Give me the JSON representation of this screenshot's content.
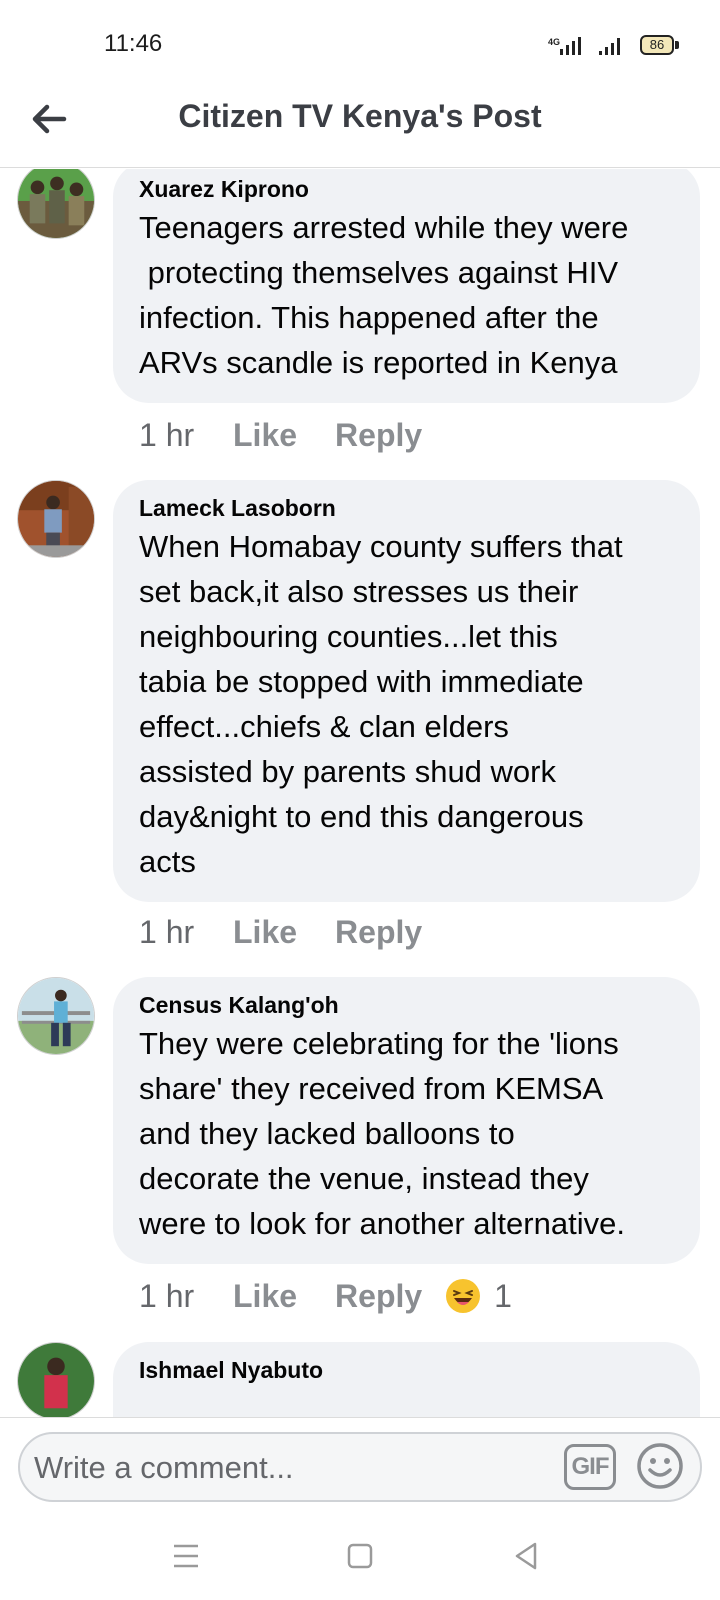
{
  "status_bar": {
    "time": "11:46",
    "network": "4G",
    "battery": "86"
  },
  "header": {
    "title": "Citizen TV Kenya's Post"
  },
  "comments": [
    {
      "author": "Xuarez Kiprono",
      "text": "Teenagers arrested while they were\n protecting themselves against HIV\ninfection. This happened after the\nARVs scandle is reported in Kenya",
      "time": "1 hr",
      "like": "Like",
      "reply": "Reply"
    },
    {
      "author": "Lameck Lasoborn",
      "text": "When Homabay county suffers that\nset back,it also stresses us their\nneighbouring counties...let this\ntabia be stopped with immediate\neffect...chiefs & clan elders\nassisted by parents shud work\nday&night to end this dangerous\nacts",
      "time": "1 hr",
      "like": "Like",
      "reply": "Reply"
    },
    {
      "author": "Census Kalang'oh",
      "text": "They were celebrating for the 'lions\nshare' they received from KEMSA\nand they lacked balloons to\ndecorate the venue, instead they\nwere to look for another alternative.",
      "time": "1 hr",
      "like": "Like",
      "reply": "Reply",
      "reaction_icon": "laughing-emoji-icon",
      "reaction_count": "1"
    },
    {
      "author": "Ishmael Nyabuto"
    }
  ],
  "composer": {
    "placeholder": "Write a comment...",
    "gif_label": "GIF"
  },
  "icons": {
    "back": "arrow-left-icon",
    "sticker": "smiley-icon",
    "nav_menu": "menu-icon",
    "nav_home": "square-icon",
    "nav_back": "triangle-back-icon"
  },
  "colors": {
    "bubble": "#f0f2f5",
    "secondary_text": "#65676b",
    "action_text": "#8a8d91"
  }
}
